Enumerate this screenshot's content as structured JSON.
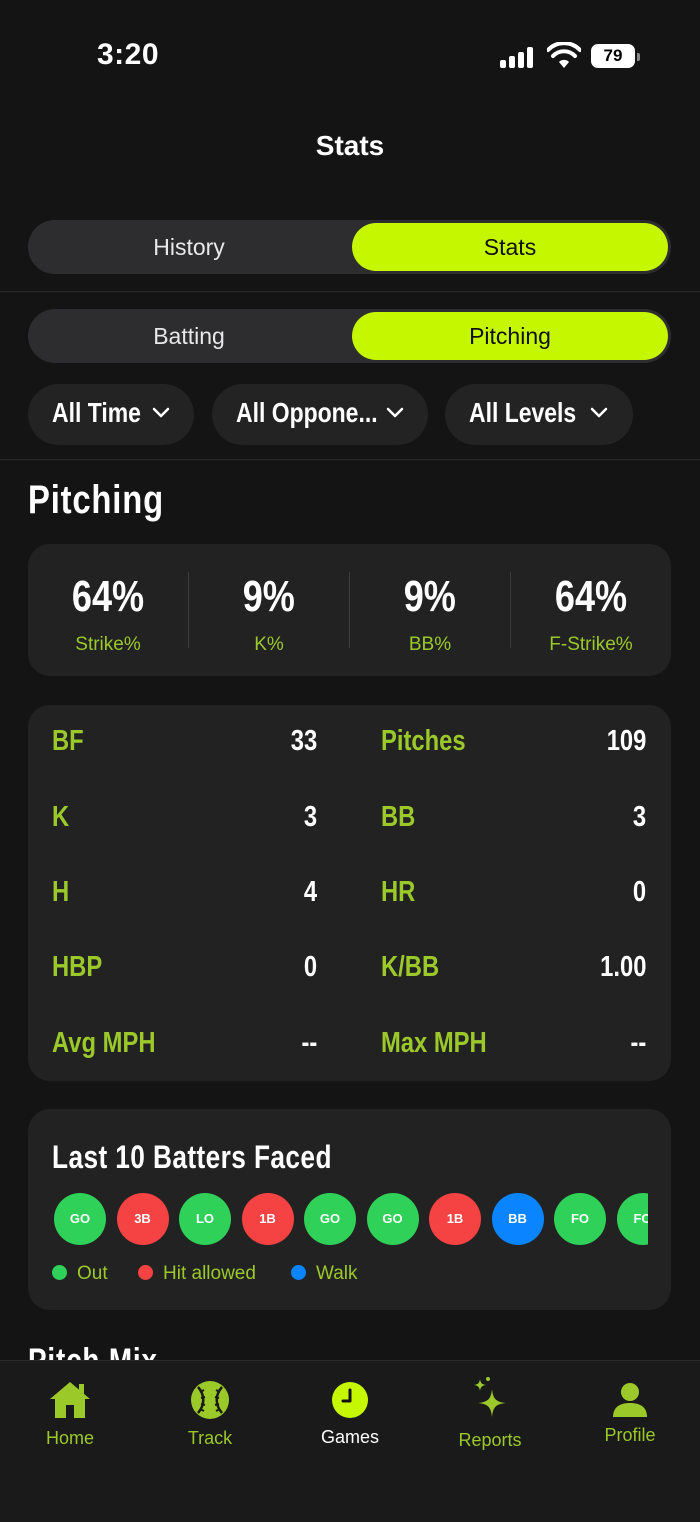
{
  "status_bar": {
    "time": "3:20",
    "battery": "79"
  },
  "header": {
    "title": "Stats"
  },
  "main_tabs": {
    "left": "History",
    "right": "Stats",
    "active": "Stats"
  },
  "mode_tabs": {
    "left": "Batting",
    "right": "Pitching",
    "active": "Pitching"
  },
  "filters": [
    {
      "label": "All Time"
    },
    {
      "label": "All Oppone..."
    },
    {
      "label": "All Levels"
    }
  ],
  "section_title": "Pitching",
  "summary": [
    {
      "value": "64%",
      "label": "Strike%"
    },
    {
      "value": "9%",
      "label": "K%"
    },
    {
      "value": "9%",
      "label": "BB%"
    },
    {
      "value": "64%",
      "label": "F-Strike%"
    }
  ],
  "stats": [
    {
      "label": "BF",
      "value": "33"
    },
    {
      "label": "Pitches",
      "value": "109"
    },
    {
      "label": "K",
      "value": "3"
    },
    {
      "label": "BB",
      "value": "3"
    },
    {
      "label": "H",
      "value": "4"
    },
    {
      "label": "HR",
      "value": "0"
    },
    {
      "label": "HBP",
      "value": "0"
    },
    {
      "label": "K/BB",
      "value": "1.00"
    },
    {
      "label": "Avg MPH",
      "value": "--"
    },
    {
      "label": "Max MPH",
      "value": "--"
    }
  ],
  "last_batters": {
    "title": "Last 10 Batters Faced",
    "results": [
      {
        "code": "GO",
        "type": "out"
      },
      {
        "code": "3B",
        "type": "hit"
      },
      {
        "code": "LO",
        "type": "out"
      },
      {
        "code": "1B",
        "type": "hit"
      },
      {
        "code": "GO",
        "type": "out"
      },
      {
        "code": "GO",
        "type": "out"
      },
      {
        "code": "1B",
        "type": "hit"
      },
      {
        "code": "BB",
        "type": "walk"
      },
      {
        "code": "FO",
        "type": "out"
      },
      {
        "code": "FO",
        "type": "out"
      }
    ],
    "legend": [
      {
        "label": "Out",
        "color": "#2fd158"
      },
      {
        "label": "Hit allowed",
        "color": "#f54242"
      },
      {
        "label": "Walk",
        "color": "#0a84ff"
      }
    ]
  },
  "next_section_title": "Pitch Mix",
  "tab_bar": [
    {
      "label": "Home",
      "icon": "home-icon"
    },
    {
      "label": "Track",
      "icon": "baseball-icon"
    },
    {
      "label": "Games",
      "icon": "clock-icon",
      "active": true
    },
    {
      "label": "Reports",
      "icon": "sparkles-icon"
    },
    {
      "label": "Profile",
      "icon": "person-icon"
    }
  ],
  "colors": {
    "accent": "#c5f700",
    "label_green": "#9bc92a",
    "background": "#141414",
    "card": "#222222"
  }
}
